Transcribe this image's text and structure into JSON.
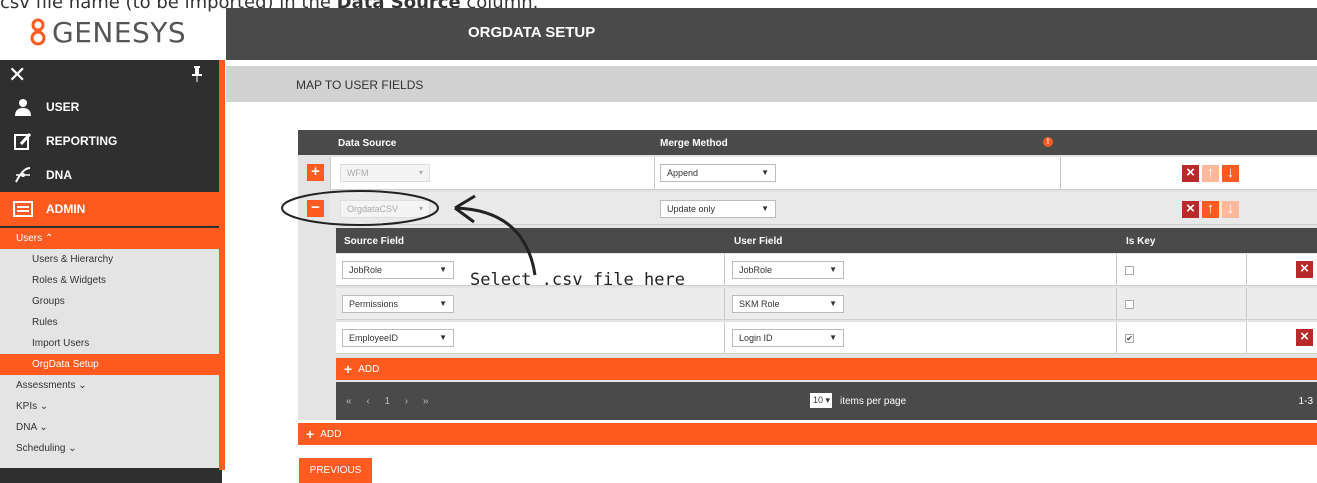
{
  "caption": {
    "prefix": "csv file name (to be imported) in the ",
    "bold": "Data Source",
    "suffix": " column."
  },
  "logo": {
    "text": "GENESYS",
    "trademark": "®"
  },
  "header": {
    "title": "ORGDATA SETUP"
  },
  "subheader": {
    "title": "MAP TO USER FIELDS"
  },
  "sidebar": {
    "close_label": "✕",
    "items": [
      {
        "label": "USER",
        "icon": "user-icon"
      },
      {
        "label": "REPORTING",
        "icon": "reporting-icon"
      },
      {
        "label": "DNA",
        "icon": "dna-icon"
      },
      {
        "label": "ADMIN",
        "icon": "admin-icon"
      }
    ],
    "users_head": "Users ⌃",
    "users_sub": [
      "Users & Hierarchy",
      "Roles & Widgets",
      "Groups",
      "Rules",
      "Import Users",
      "OrgData Setup"
    ],
    "groups": [
      "Assessments ⌄",
      "KPIs ⌄",
      "DNA ⌄",
      "Scheduling ⌄"
    ]
  },
  "grid": {
    "headers": {
      "data_source": "Data Source",
      "merge_method": "Merge Method"
    },
    "rows": [
      {
        "toggle": "+",
        "data_source": "WFM",
        "merge_method": "Append"
      },
      {
        "toggle": "−",
        "data_source": "OrgdataCSV",
        "merge_method": "Update only"
      }
    ]
  },
  "mapping": {
    "headers": {
      "source": "Source Field",
      "user": "User Field",
      "key": "Is Key"
    },
    "rows": [
      {
        "source": "JobRole",
        "user": "JobRole",
        "is_key": false
      },
      {
        "source": "Permissions",
        "user": "SKM Role",
        "is_key": false
      },
      {
        "source": "EmployeeID",
        "user": "Login ID",
        "is_key": true
      }
    ],
    "add_label": "ADD"
  },
  "pager": {
    "nav": "« ‹ 1 › »",
    "current_page": "1",
    "page_size": "10",
    "items_per_page": "items per page",
    "range": "1-3"
  },
  "outer_add_label": "ADD",
  "previous_label": "PREVIOUS",
  "annotation": "Select .csv file here",
  "colors": {
    "accent": "#ff5a1f",
    "dark": "#4a4a4a",
    "danger": "#b82a2a"
  }
}
